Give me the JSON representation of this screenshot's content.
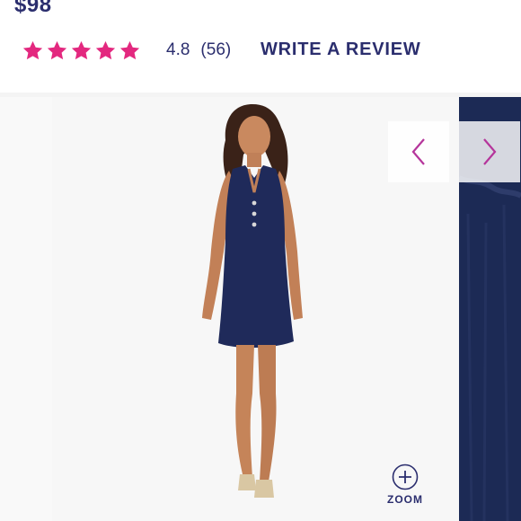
{
  "product": {
    "price": "$98",
    "rating": {
      "stars": 5,
      "score": "4.8",
      "count": "(56)",
      "write_review_label": "WRITE A REVIEW"
    }
  },
  "gallery": {
    "prev_icon": "chevron-left-icon",
    "next_icon": "chevron-right-icon",
    "zoom_icon": "zoom-plus-icon",
    "zoom_label": "ZOOM"
  },
  "colors": {
    "brand_navy": "#2b2e6e",
    "star_pink": "#e3287f",
    "arrow_magenta": "#b5359b",
    "dress_navy": "#1f2a5a"
  }
}
